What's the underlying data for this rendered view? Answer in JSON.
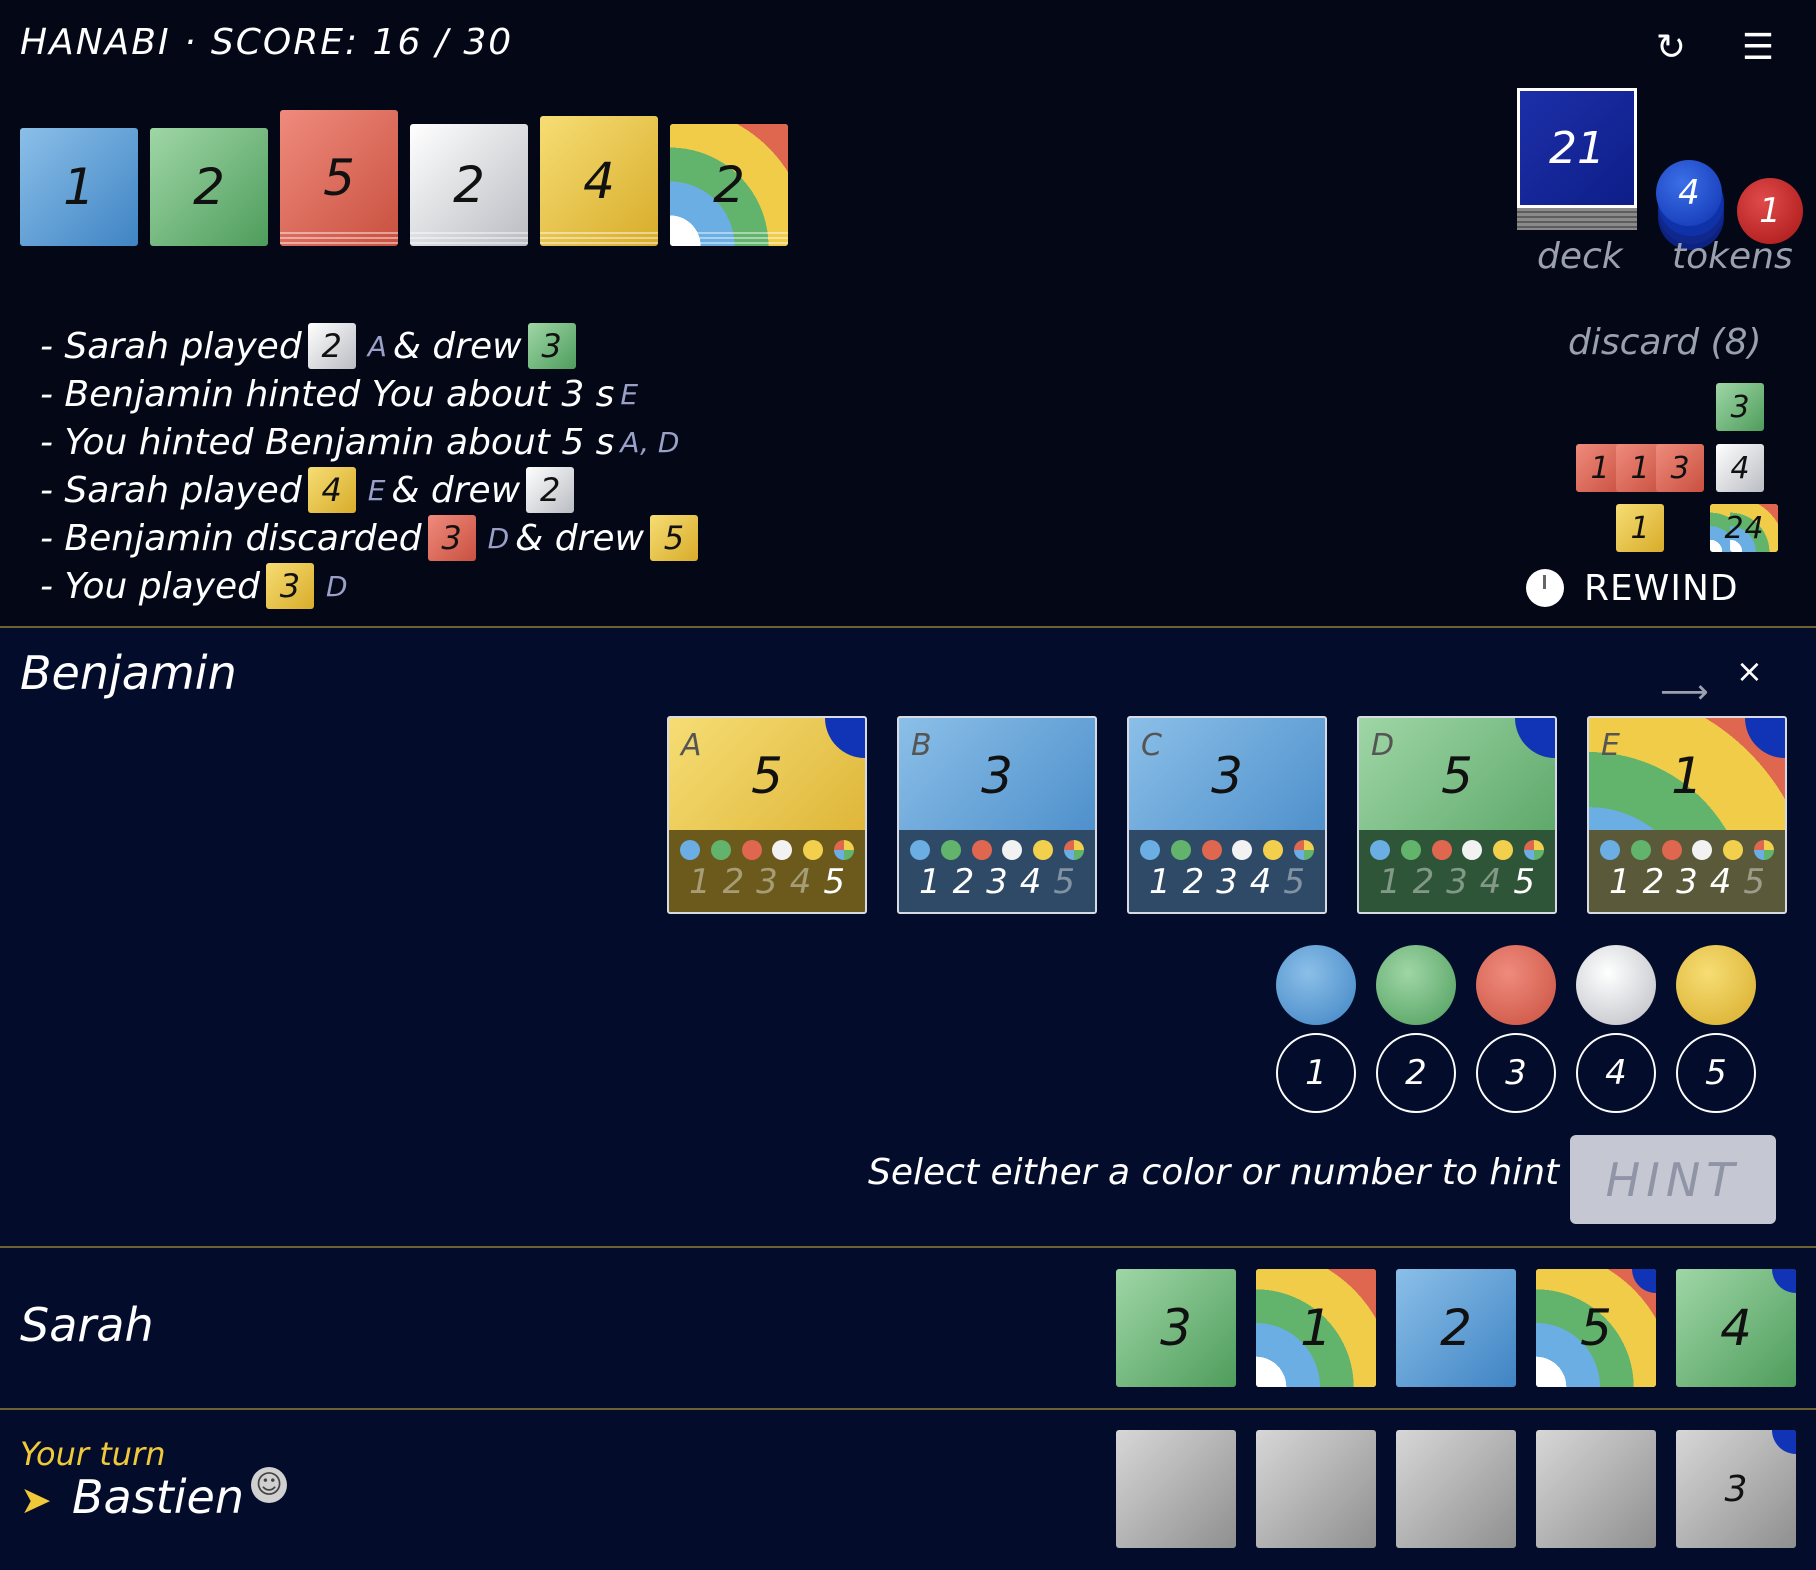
{
  "header": {
    "title": "HANABI · SCORE: 16 / 30",
    "undo_icon": "undo-icon",
    "menu_icon": "menu-icon"
  },
  "fireworks": [
    {
      "color": "blue",
      "value": "1"
    },
    {
      "color": "green",
      "value": "2"
    },
    {
      "color": "red",
      "value": "5"
    },
    {
      "color": "white",
      "value": "2"
    },
    {
      "color": "yellow",
      "value": "4"
    },
    {
      "color": "rainbow",
      "value": "2"
    }
  ],
  "deck": {
    "count": "21",
    "label": "deck"
  },
  "tokens": {
    "hint": "4",
    "strike": "1",
    "label": "tokens"
  },
  "log": [
    {
      "prefix": "- Sarah played",
      "card1": {
        "color": "white",
        "value": "2"
      },
      "letter1": "A",
      "mid": "& drew",
      "card2": {
        "color": "green",
        "value": "3"
      }
    },
    {
      "prefix": "- Benjamin hinted You about 3 s",
      "letter1": "E"
    },
    {
      "prefix": "- You hinted Benjamin about 5 s",
      "letter1": "A, D"
    },
    {
      "prefix": "- Sarah played",
      "card1": {
        "color": "yellow",
        "value": "4"
      },
      "letter1": "E",
      "mid": "& drew",
      "card2": {
        "color": "white",
        "value": "2"
      }
    },
    {
      "prefix": "- Benjamin discarded",
      "card1": {
        "color": "red",
        "value": "3"
      },
      "letter1": "D",
      "mid": "& drew",
      "card2": {
        "color": "yellow",
        "value": "5"
      }
    },
    {
      "prefix": "- You played",
      "card1": {
        "color": "yellow",
        "value": "3"
      },
      "letter1": "D"
    }
  ],
  "discard": {
    "label": "discard (8)",
    "cards": [
      {
        "color": "green",
        "value": "3"
      },
      {
        "color": "red",
        "value": "1"
      },
      {
        "color": "red",
        "value": "1"
      },
      {
        "color": "red",
        "value": "3"
      },
      {
        "color": "white",
        "value": "4"
      },
      {
        "color": "yellow",
        "value": "1"
      },
      {
        "color": "rainbow",
        "value": "2"
      },
      {
        "color": "rainbow",
        "value": "4"
      }
    ]
  },
  "rewind": {
    "label": "REWIND"
  },
  "benjamin": {
    "name": "Benjamin",
    "next_icon": "arrow-right-icon",
    "close_label": "×",
    "cards": [
      {
        "letter": "A",
        "value": "5",
        "color": "yellow",
        "hinted": true,
        "numbers": [
          "1",
          "2",
          "3",
          "4",
          "5"
        ],
        "bottom": "#6b5a1b"
      },
      {
        "letter": "B",
        "value": "3",
        "color": "blue",
        "hinted": false,
        "numbers": [
          "1",
          "2",
          "3",
          "4",
          "5"
        ],
        "bottom": "#2f4a66"
      },
      {
        "letter": "C",
        "value": "3",
        "color": "blue",
        "hinted": false,
        "numbers": [
          "1",
          "2",
          "3",
          "4",
          "5"
        ],
        "bottom": "#2f4a66"
      },
      {
        "letter": "D",
        "value": "5",
        "color": "green",
        "hinted": true,
        "numbers": [
          "1",
          "2",
          "3",
          "4",
          "5"
        ],
        "bottom": "#2f5538"
      },
      {
        "letter": "E",
        "value": "1",
        "color": "rainbow",
        "hinted": true,
        "numbers": [
          "1",
          "2",
          "3",
          "4",
          "5"
        ],
        "bottom": "#5a5a3a"
      }
    ]
  },
  "hint_panel": {
    "colors": [
      "blue",
      "green",
      "red",
      "white",
      "yellow"
    ],
    "numbers": [
      "1",
      "2",
      "3",
      "4",
      "5"
    ],
    "prompt": "Select either a color or number to hint",
    "button": "HINT"
  },
  "sarah": {
    "name": "Sarah",
    "cards": [
      {
        "color": "green",
        "value": "3"
      },
      {
        "color": "rainbow",
        "value": "1"
      },
      {
        "color": "blue",
        "value": "2"
      },
      {
        "color": "rainbow",
        "value": "5",
        "hinted": true
      },
      {
        "color": "green",
        "value": "4",
        "hinted": true
      }
    ]
  },
  "self": {
    "turn_label": "Your turn",
    "arrow": "➤",
    "name": "Bastien",
    "emoji": "☺",
    "cards": [
      {
        "value": ""
      },
      {
        "value": ""
      },
      {
        "value": ""
      },
      {
        "value": ""
      },
      {
        "value": "3",
        "hinted": true
      }
    ]
  }
}
